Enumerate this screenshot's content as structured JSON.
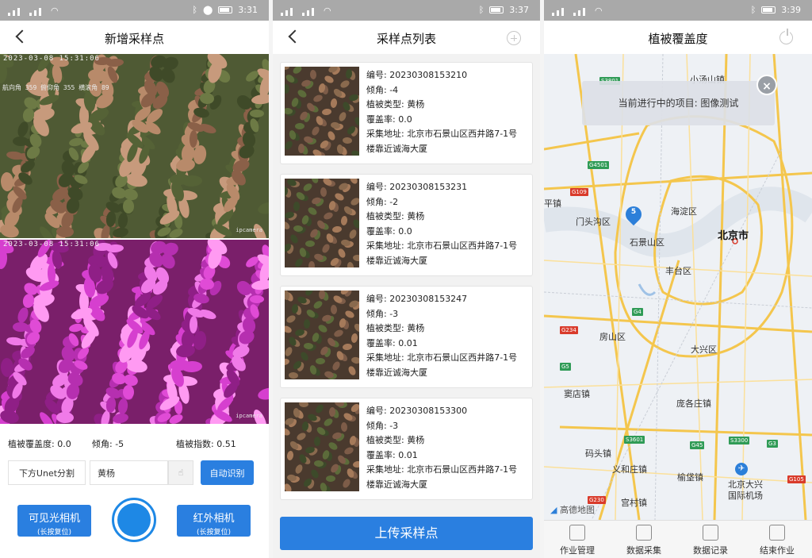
{
  "screen1": {
    "status": {
      "time": "3:31"
    },
    "title": "新增采样点",
    "visible_feed": {
      "timestamp": "2023-03-08 15:31:06",
      "overlay": "航向角 359  俯仰角 355  横滚角 89",
      "camera_tag": "ipcamera"
    },
    "infrared_feed": {
      "timestamp": "2023-03-08 15:31:06",
      "camera_tag": "ipcamera"
    },
    "metrics": {
      "coverage": "植被覆盖度: 0.0",
      "tilt": "倾角: -5",
      "index": "植被指数: 0.51"
    },
    "segment_button": "下方Unet分割",
    "species_value": "黄杨",
    "auto_button": "自动识别",
    "visible_camera": {
      "label": "可见光相机",
      "hint": "(长按复位)"
    },
    "ir_camera": {
      "label": "红外相机",
      "hint": "(长按复位)"
    }
  },
  "screen2": {
    "status": {
      "time": "3:37"
    },
    "title": "采样点列表",
    "records": [
      {
        "id": "编号: 20230308153210",
        "tilt": "倾角: -4",
        "type": "植被类型: 黄杨",
        "coverage": "覆盖率: 0.0",
        "addr1": "采集地址: 北京市石景山区西井路7-1号",
        "addr2": "楼靠近诚海大厦"
      },
      {
        "id": "编号: 20230308153231",
        "tilt": "倾角: -2",
        "type": "植被类型: 黄杨",
        "coverage": "覆盖率: 0.0",
        "addr1": "采集地址: 北京市石景山区西井路7-1号",
        "addr2": "楼靠近诚海大厦"
      },
      {
        "id": "编号: 20230308153247",
        "tilt": "倾角: -3",
        "type": "植被类型: 黄杨",
        "coverage": "覆盖率: 0.01",
        "addr1": "采集地址: 北京市石景山区西井路7-1号",
        "addr2": "楼靠近诚海大厦"
      },
      {
        "id": "编号: 20230308153300",
        "tilt": "倾角: -3",
        "type": "植被类型: 黄杨",
        "coverage": "覆盖率: 0.01",
        "addr1": "采集地址: 北京市石景山区西井路7-1号",
        "addr2": "楼靠近诚海大厦"
      }
    ],
    "upload_button": "上传采样点"
  },
  "screen3": {
    "status": {
      "time": "3:39"
    },
    "title": "植被覆盖度",
    "banner": "当前进行中的项目: 图像测试",
    "marker_count": "5",
    "labels": {
      "xiaotangshan": "小汤山镇",
      "haidian": "海淀区",
      "mentougou": "门头沟区",
      "shijingshan": "石景山区",
      "beijing": "北京市",
      "fengtai": "丰台区",
      "fangshan": "房山区",
      "daxing": "大兴区",
      "doudian": "窦店镇",
      "panggezhuang": "庞各庄镇",
      "majuqiao": "码头镇",
      "yihezhuang": "义和庄镇",
      "yufa": "榆垡镇",
      "airport1": "北京大兴",
      "airport2": "国际机场",
      "gongcun": "宫村镇",
      "zhen": "平镇"
    },
    "road_tags": {
      "s3801": "S3801",
      "g4501": "G4501",
      "g109": "G109",
      "g4": "G4",
      "g234": "G234",
      "g5": "G5",
      "s3601": "S3601",
      "g45": "G45",
      "s3300": "S3300",
      "g3": "G3",
      "g105": "G105",
      "g230": "G230"
    },
    "map_logo": "高德地图",
    "tabs": [
      "作业管理",
      "数据采集",
      "数据记录",
      "结束作业"
    ]
  }
}
